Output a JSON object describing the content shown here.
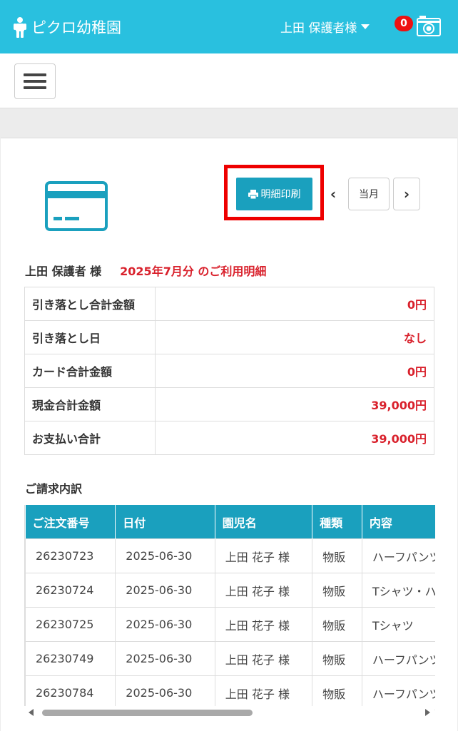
{
  "header": {
    "app_name": "ピクロ幼稚園",
    "user_name": "上田 保護者様",
    "notification_count": "0",
    "brand_color": "#29c0df"
  },
  "toolbar": {
    "print_label": "明細印刷",
    "current_month_label": "当月",
    "prev_icon": "chevron-left-icon",
    "next_icon": "chevron-right-icon"
  },
  "summary": {
    "guardian": "上田 保護者 様",
    "period": "2025年7月分 のご利用明細",
    "rows": [
      {
        "label": "引き落とし合計金額",
        "value": "0円"
      },
      {
        "label": "引き落とし日",
        "value": "なし"
      },
      {
        "label": "カード合計金額",
        "value": "0円"
      },
      {
        "label": "現金合計金額",
        "value": "39,000円"
      },
      {
        "label": "お支払い合計",
        "value": "39,000円"
      }
    ]
  },
  "breakdown": {
    "title": "ご請求内訳",
    "headers": [
      "ご注文番号",
      "日付",
      "園児名",
      "種類",
      "内容"
    ],
    "rows": [
      [
        "26230723",
        "2025-06-30",
        "上田 花子 様",
        "物販",
        "ハーフパンツ"
      ],
      [
        "26230724",
        "2025-06-30",
        "上田 花子 様",
        "物販",
        "Tシャツ・ハーフパンツ"
      ],
      [
        "26230725",
        "2025-06-30",
        "上田 花子 様",
        "物販",
        "Tシャツ"
      ],
      [
        "26230749",
        "2025-06-30",
        "上田 花子 様",
        "物販",
        "ハーフパンツ"
      ],
      [
        "26230784",
        "2025-06-30",
        "上田 花子 様",
        "物販",
        "ハーフパンツ"
      ]
    ]
  },
  "colors": {
    "accent": "#1aa0be",
    "amount_red": "#d9212c",
    "highlight_red": "#ee0000"
  }
}
